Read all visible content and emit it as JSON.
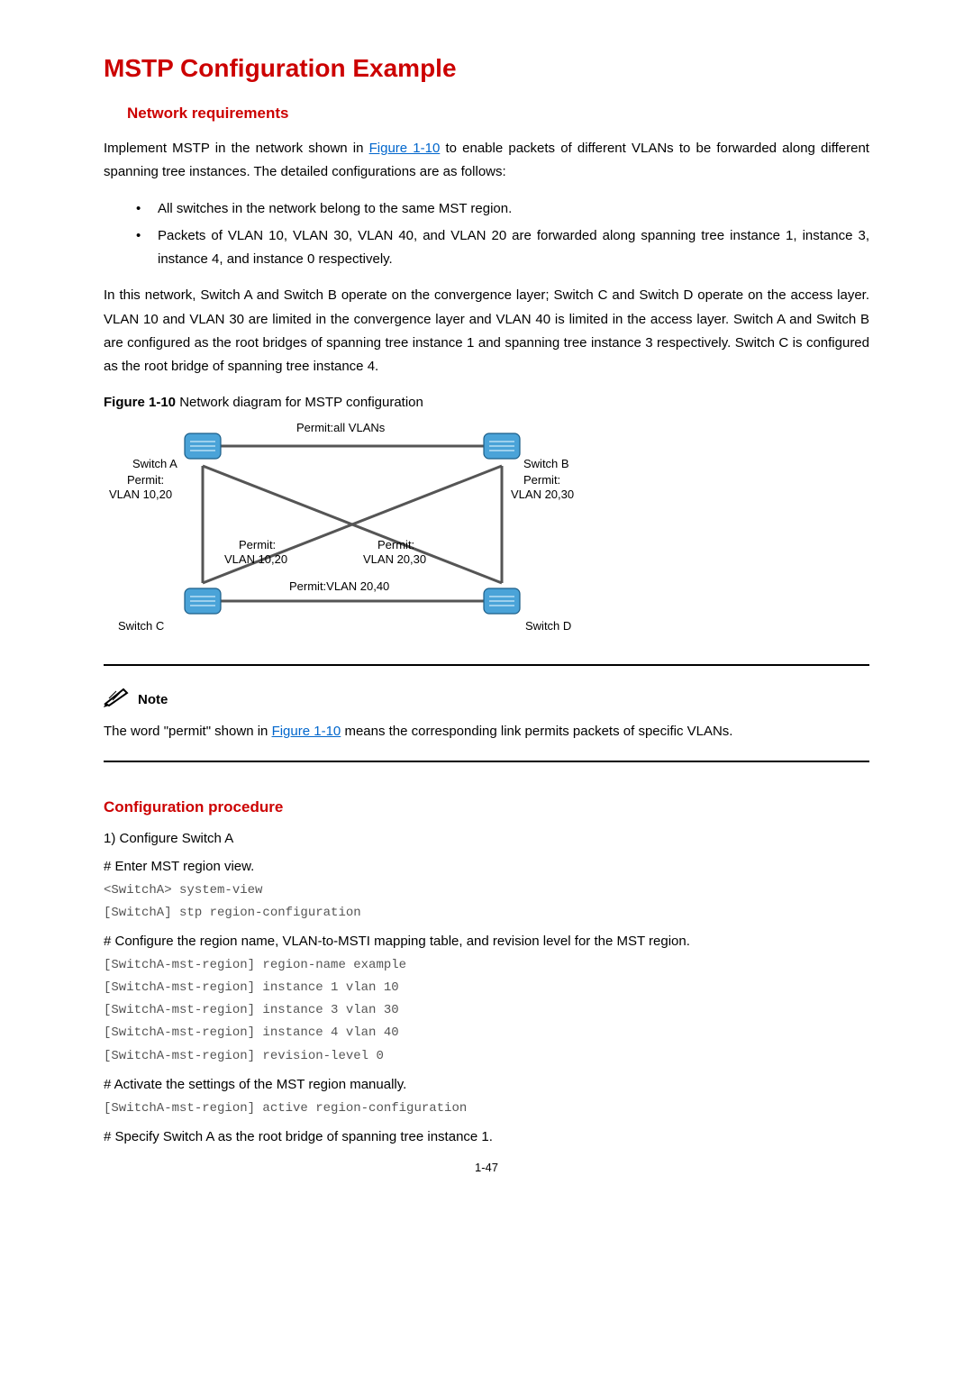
{
  "headings": {
    "h1": "MSTP Configuration Example",
    "network_req": "Network requirements",
    "config_proc": "Configuration procedure"
  },
  "intro": {
    "p1_a": "Implement MSTP in the network shown in ",
    "p1_link": "Figure 1-10",
    "p1_b": " to enable packets of different VLANs to be forwarded along different spanning tree instances. The detailed configurations are as follows:",
    "b1": "All switches in the network belong to the same MST region.",
    "b2": "Packets of VLAN 10, VLAN 30, VLAN 40, and VLAN 20 are forwarded along spanning tree instance 1, instance 3, instance 4, and instance 0 respectively.",
    "p2": "In this network, Switch A and Switch B operate on the convergence layer; Switch C and Switch D operate on the access layer. VLAN 10 and VLAN 30 are limited in the convergence layer and VLAN 40 is limited in the access layer. Switch A and Switch B are configured as the root bridges of spanning tree instance 1 and spanning tree instance 3 respectively. Switch C is configured as the root bridge of spanning tree instance 4."
  },
  "figure": {
    "caption_bold": "Figure 1-10",
    "caption_rest": " Network diagram for MSTP configuration",
    "labels": {
      "switchA": "Switch A",
      "switchB": "Switch B",
      "switchC": "Switch C",
      "switchD": "Switch D",
      "permit_all": "Permit:all VLANs",
      "permit_top_left_1": "Permit:",
      "permit_top_left_2": "VLAN 10,20",
      "permit_top_right_1": "Permit:",
      "permit_top_right_2": "VLAN 20,30",
      "permit_diag_left_1": "Permit:",
      "permit_diag_left_2": "VLAN 10,20",
      "permit_diag_right_1": "Permit:",
      "permit_diag_right_2": "VLAN 20,30",
      "permit_bottom": "Permit:VLAN 20,40"
    }
  },
  "note": {
    "label": "Note",
    "text_a": "The word \"permit\" shown in ",
    "text_link": "Figure 1-10",
    "text_b": " means the corresponding link permits packets of specific VLANs."
  },
  "config": {
    "step1": "1)    Configure Switch A",
    "s1": "# Enter MST region view.",
    "c1": "<SwitchA> system-view\n[SwitchA] stp region-configuration",
    "s2": "# Configure the region name, VLAN-to-MSTI mapping table, and revision level for the MST region.",
    "c2": "[SwitchA-mst-region] region-name example\n[SwitchA-mst-region] instance 1 vlan 10\n[SwitchA-mst-region] instance 3 vlan 30\n[SwitchA-mst-region] instance 4 vlan 40\n[SwitchA-mst-region] revision-level 0",
    "s3": "# Activate the settings of the MST region manually.",
    "c3": "[SwitchA-mst-region] active region-configuration",
    "s4": "# Specify Switch A as the root bridge of spanning tree instance 1."
  },
  "page_num": "1-47"
}
